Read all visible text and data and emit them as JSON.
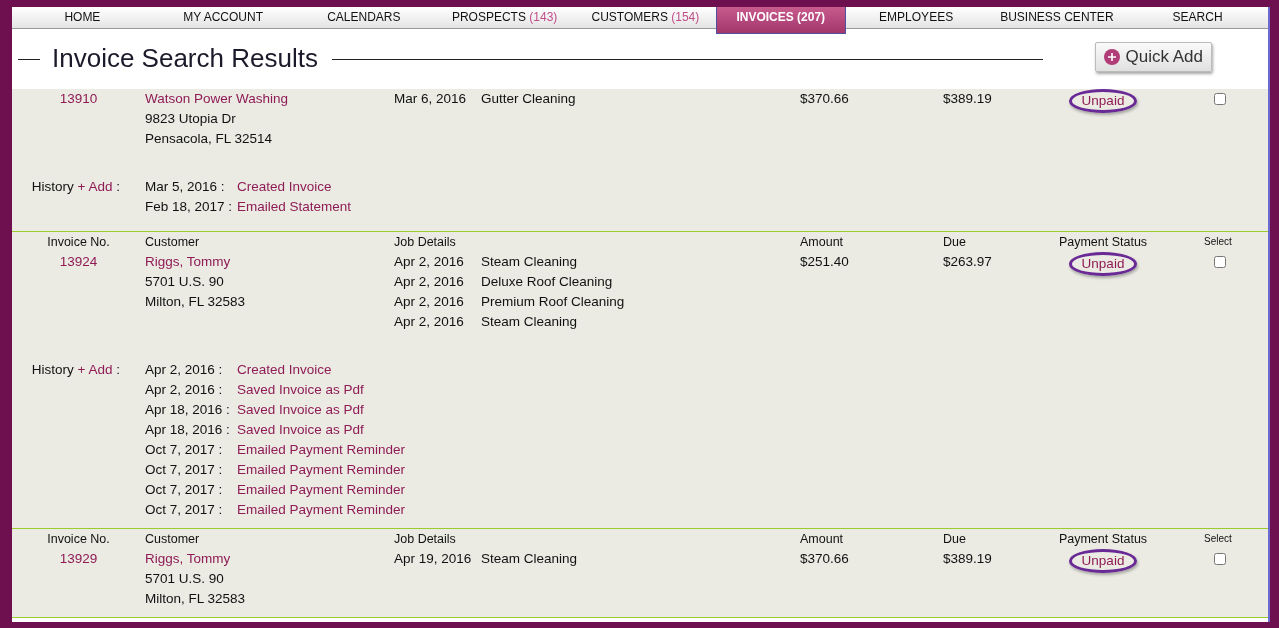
{
  "nav": [
    {
      "label": "HOME",
      "selected": false
    },
    {
      "label": "MY ACCOUNT",
      "selected": false
    },
    {
      "label": "CALENDARS",
      "selected": false
    },
    {
      "label": "PROSPECTS",
      "count": "(143)",
      "selected": false
    },
    {
      "label": "CUSTOMERS",
      "count": "(154)",
      "selected": false
    },
    {
      "label": "INVOICES (207)",
      "selected": true
    },
    {
      "label": "EMPLOYEES",
      "selected": false
    },
    {
      "label": "BUSINESS CENTER",
      "selected": false
    },
    {
      "label": "SEARCH",
      "selected": false
    }
  ],
  "page_title": "Invoice Search Results",
  "quick_add": "Quick Add",
  "invoices": [
    {
      "number": "13910",
      "customer": {
        "name": "Watson Power Washing",
        "address": [
          "9823 Utopia Dr",
          "Pensacola, FL 32514"
        ]
      },
      "jobs": [
        {
          "date": "Mar 6, 2016",
          "service": "Gutter Cleaning"
        }
      ],
      "amount": "$370.66",
      "due": "$389.19",
      "status": "Unpaid",
      "selected": false,
      "history_label": "History",
      "history_add": "+ Add",
      "history_colon": ":",
      "history": [
        {
          "date": "Mar 5, 2016 :",
          "event": "Created Invoice"
        },
        {
          "date": "Feb 18, 2017 :",
          "event": "Emailed Statement"
        }
      ]
    },
    {
      "headers": {
        "number": "Invoice No.",
        "customer": "Customer",
        "jobs": "Job Details",
        "amount": "Amount",
        "due": "Due",
        "status": "Payment Status",
        "select": "Select"
      },
      "number": "13924",
      "customer": {
        "name": "Riggs, Tommy",
        "address": [
          "5701 U.S. 90",
          "Milton, FL 32583"
        ]
      },
      "jobs": [
        {
          "date": "Apr 2, 2016",
          "service": "Steam Cleaning"
        },
        {
          "date": "Apr 2, 2016",
          "service": "Deluxe Roof Cleaning"
        },
        {
          "date": "Apr 2, 2016",
          "service": "Premium Roof Cleaning"
        },
        {
          "date": "Apr 2, 2016",
          "service": "Steam Cleaning"
        }
      ],
      "amount": "$251.40",
      "due": "$263.97",
      "status": "Unpaid",
      "selected": false,
      "history_label": "History",
      "history_add": "+ Add",
      "history_colon": ":",
      "history": [
        {
          "date": "Apr 2, 2016 :",
          "event": "Created Invoice"
        },
        {
          "date": "Apr 2, 2016 :",
          "event": "Saved Invoice as Pdf"
        },
        {
          "date": "Apr 18, 2016 :",
          "event": "Saved Invoice as Pdf"
        },
        {
          "date": "Apr 18, 2016 :",
          "event": "Saved Invoice as Pdf"
        },
        {
          "date": "Oct 7, 2017 :",
          "event": "Emailed Payment Reminder"
        },
        {
          "date": "Oct 7, 2017 :",
          "event": "Emailed Payment Reminder"
        },
        {
          "date": "Oct 7, 2017 :",
          "event": "Emailed Payment Reminder"
        },
        {
          "date": "Oct 7, 2017 :",
          "event": "Emailed Payment Reminder"
        }
      ]
    },
    {
      "headers": {
        "number": "Invoice No.",
        "customer": "Customer",
        "jobs": "Job Details",
        "amount": "Amount",
        "due": "Due",
        "status": "Payment Status",
        "select": "Select"
      },
      "number": "13929",
      "customer": {
        "name": "Riggs, Tommy",
        "address": [
          "5701 U.S. 90",
          "Milton, FL 32583"
        ]
      },
      "jobs": [
        {
          "date": "Apr 19, 2016",
          "service": "Steam Cleaning"
        }
      ],
      "amount": "$370.66",
      "due": "$389.19",
      "status": "Unpaid",
      "selected": false
    }
  ]
}
